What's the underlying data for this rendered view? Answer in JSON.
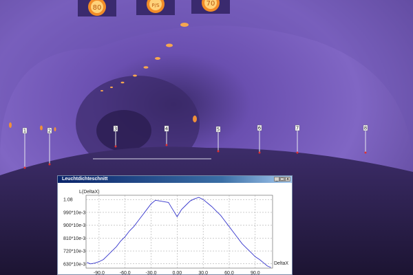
{
  "scene": {
    "markers": [
      "1",
      "2",
      "3",
      "4",
      "5",
      "6",
      "7",
      "8"
    ],
    "sign_glyphs": [
      "80",
      "P/S",
      "70"
    ]
  },
  "window": {
    "title": "Leuchtdichteschnitt",
    "buttons": {
      "minimize": "_",
      "maximize": "□",
      "close": "x"
    }
  },
  "chart_data": {
    "type": "line",
    "xlabel": "DeltaX",
    "ylabel": "L(DeltaX)",
    "xlim": [
      -105,
      110
    ],
    "ylim": [
      0.6,
      1.11
    ],
    "x_ticks": [
      {
        "v": -90,
        "label": "-90.0"
      },
      {
        "v": -60,
        "label": "-60.0"
      },
      {
        "v": -30,
        "label": "-30.0"
      },
      {
        "v": 0,
        "label": "0.00"
      },
      {
        "v": 30,
        "label": "30.0"
      },
      {
        "v": 60,
        "label": "60.0"
      },
      {
        "v": 90,
        "label": "90.0"
      }
    ],
    "y_ticks": [
      {
        "v": 0.63,
        "label": "630*10e-3"
      },
      {
        "v": 0.72,
        "label": "720*10e-3"
      },
      {
        "v": 0.81,
        "label": "810*10e-3"
      },
      {
        "v": 0.9,
        "label": "900*10e-3"
      },
      {
        "v": 0.99,
        "label": "990*10e-3"
      },
      {
        "v": 1.08,
        "label": "1.08"
      }
    ],
    "grid": true,
    "series": [
      {
        "x": [
          -104,
          -100,
          -95,
          -90,
          -85,
          -80,
          -75,
          -70,
          -65,
          -60,
          -55,
          -50,
          -45,
          -40,
          -35,
          -30,
          -25,
          -20,
          -15,
          -10,
          -5,
          0,
          5,
          10,
          15,
          20,
          25,
          30,
          35,
          40,
          45,
          50,
          55,
          60,
          65,
          70,
          75,
          80,
          85,
          90,
          95,
          100,
          104,
          108
        ],
        "y": [
          0.64,
          0.63,
          0.635,
          0.645,
          0.66,
          0.69,
          0.72,
          0.75,
          0.79,
          0.82,
          0.86,
          0.89,
          0.93,
          0.97,
          1.01,
          1.05,
          1.075,
          1.07,
          1.065,
          1.06,
          1.01,
          0.96,
          1.01,
          1.04,
          1.07,
          1.085,
          1.095,
          1.08,
          1.055,
          1.03,
          1.0,
          0.97,
          0.93,
          0.89,
          0.85,
          0.81,
          0.77,
          0.74,
          0.71,
          0.68,
          0.66,
          0.635,
          0.615,
          0.605
        ]
      }
    ],
    "color": "#3333cc"
  }
}
